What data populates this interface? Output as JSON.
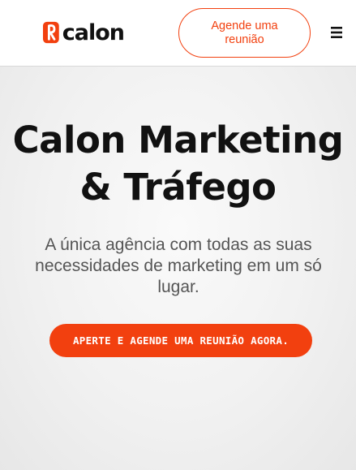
{
  "header": {
    "logo_text": "calon",
    "cta_label": "Agende uma reunião",
    "menu_icon": "hamburger-menu-icon"
  },
  "hero": {
    "title": "Calon Marketing & Tráfego",
    "subtitle": "A única agência com todas as suas necessidades de marketing em um só lugar.",
    "cta_label": "APERTE E AGENDE UMA REUNIÃO AGORA."
  },
  "colors": {
    "accent": "#f2400f",
    "text_dark": "#111111",
    "text_muted": "#555555",
    "hero_bg": "#f1f1f1"
  }
}
